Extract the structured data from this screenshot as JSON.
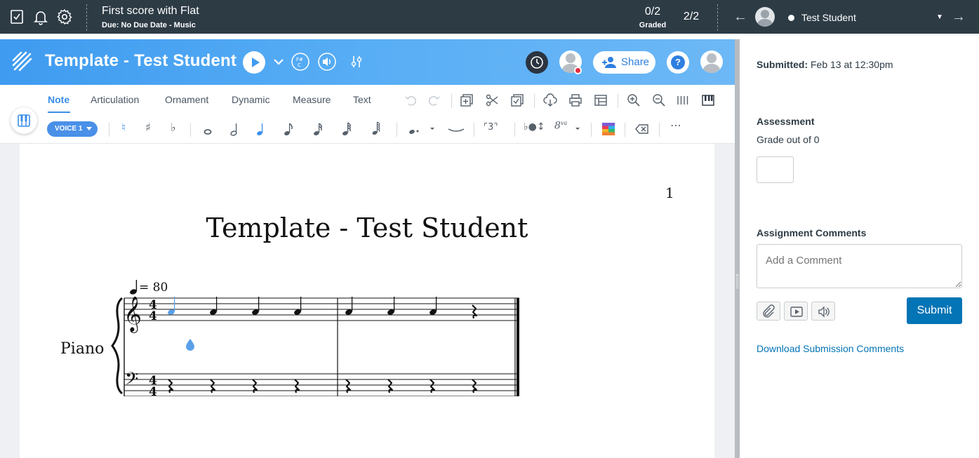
{
  "topbar": {
    "course_title": "First score with Flat",
    "due": "Due: No Due Date - Music",
    "graded_count": "0/2",
    "graded_label": "Graded",
    "student_count": "2/2",
    "student_name": "Test Student",
    "icons": [
      "grading-icon",
      "bell-icon",
      "gear-icon",
      "arrow-left-icon",
      "arrow-right-icon"
    ]
  },
  "flat": {
    "title": "Template - Test Student",
    "share_label": "Share",
    "help_label": "?",
    "tabs": [
      {
        "label": "Note",
        "active": true
      },
      {
        "label": "Articulation",
        "active": false
      },
      {
        "label": "Ornament",
        "active": false
      },
      {
        "label": "Dynamic",
        "active": false
      },
      {
        "label": "Measure",
        "active": false
      },
      {
        "label": "Text",
        "active": false
      }
    ],
    "voice_label": "VOICE 1",
    "accent_color": "#3b8ee6",
    "header_gradient": [
      "#3f9bf0",
      "#6db8f6"
    ]
  },
  "score": {
    "page_number": "1",
    "title": "Template - Test Student",
    "tempo": "= 80",
    "instrument": "Piano",
    "time_signature": "4/4"
  },
  "panel": {
    "submitted_label": "Submitted:",
    "submitted_date": "Feb 13 at 12:30pm",
    "assessment_title": "Assessment",
    "grade_label": "Grade out of 0",
    "grade_value": "",
    "comments_title": "Assignment Comments",
    "comment_placeholder": "Add a Comment",
    "submit_label": "Submit",
    "download_link": "Download Submission Comments"
  }
}
